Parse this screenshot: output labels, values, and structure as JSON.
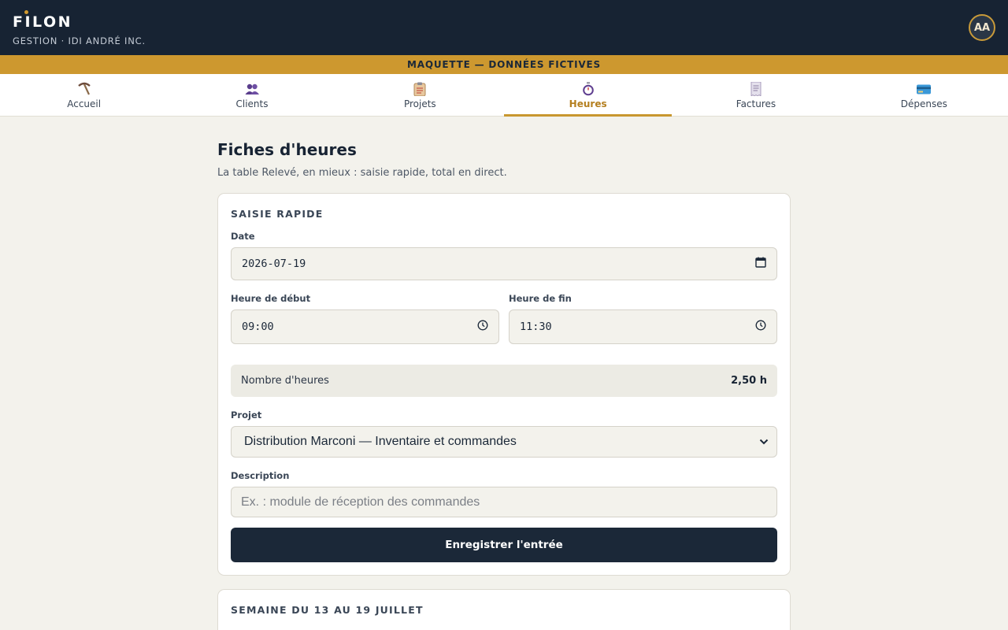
{
  "brand": {
    "logo": "FILON",
    "subtitle": "GESTION · IDI ANDRÉ INC."
  },
  "user": {
    "initials": "AA"
  },
  "banner": "MAQUETTE — DONNÉES FICTIVES",
  "nav": [
    {
      "label": "Accueil",
      "icon": "pickaxe-icon"
    },
    {
      "label": "Clients",
      "icon": "users-icon"
    },
    {
      "label": "Projets",
      "icon": "clipboard-icon"
    },
    {
      "label": "Heures",
      "icon": "stopwatch-icon",
      "active": true
    },
    {
      "label": "Factures",
      "icon": "receipt-icon"
    },
    {
      "label": "Dépenses",
      "icon": "credit-card-icon"
    }
  ],
  "page": {
    "title": "Fiches d'heures",
    "subtitle": "La table Relevé, en mieux : saisie rapide, total en direct."
  },
  "quick_entry": {
    "title": "SAISIE RAPIDE",
    "date_label": "Date",
    "date_value": "2026-07-19",
    "start_label": "Heure de début",
    "start_value": "09:00",
    "end_label": "Heure de fin",
    "end_value": "11:30",
    "hours_label": "Nombre d'heures",
    "hours_value": "2,50 h",
    "project_label": "Projet",
    "project_value": "Distribution Marconi — Inventaire et commandes",
    "description_label": "Description",
    "description_placeholder": "Ex. : module de réception des commandes",
    "submit_label": "Enregistrer l'entrée"
  },
  "week": {
    "title": "SEMAINE DU 13 AU 19 JUILLET"
  },
  "colors": {
    "navy": "#172333",
    "gold": "#cd982f",
    "background": "#f3f2ec"
  }
}
